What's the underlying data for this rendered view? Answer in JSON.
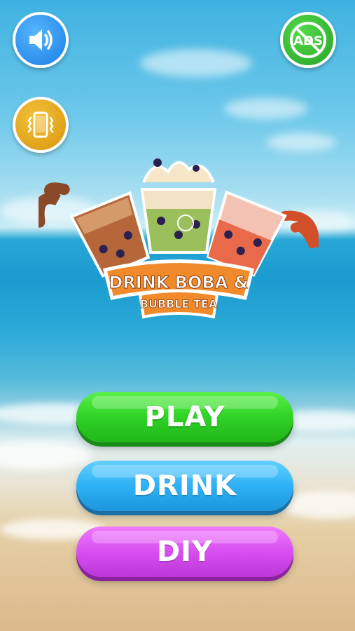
{
  "top_bar": {
    "sound_icon": "speaker-icon",
    "vibrate_icon": "phone-vibrate-icon",
    "no_ads_label": "ADS",
    "no_ads_icon": "no-ads-icon"
  },
  "logo": {
    "line1": "DRINK BOBA &",
    "line2": "BUBBLE TEA"
  },
  "menu": {
    "play_label": "PLAY",
    "drink_label": "DRINK",
    "diy_label": "DIY"
  },
  "colors": {
    "play": "#2fd226",
    "drink": "#2eb1f5",
    "diy": "#d84ff0",
    "logo_banner": "#f08a2a"
  }
}
